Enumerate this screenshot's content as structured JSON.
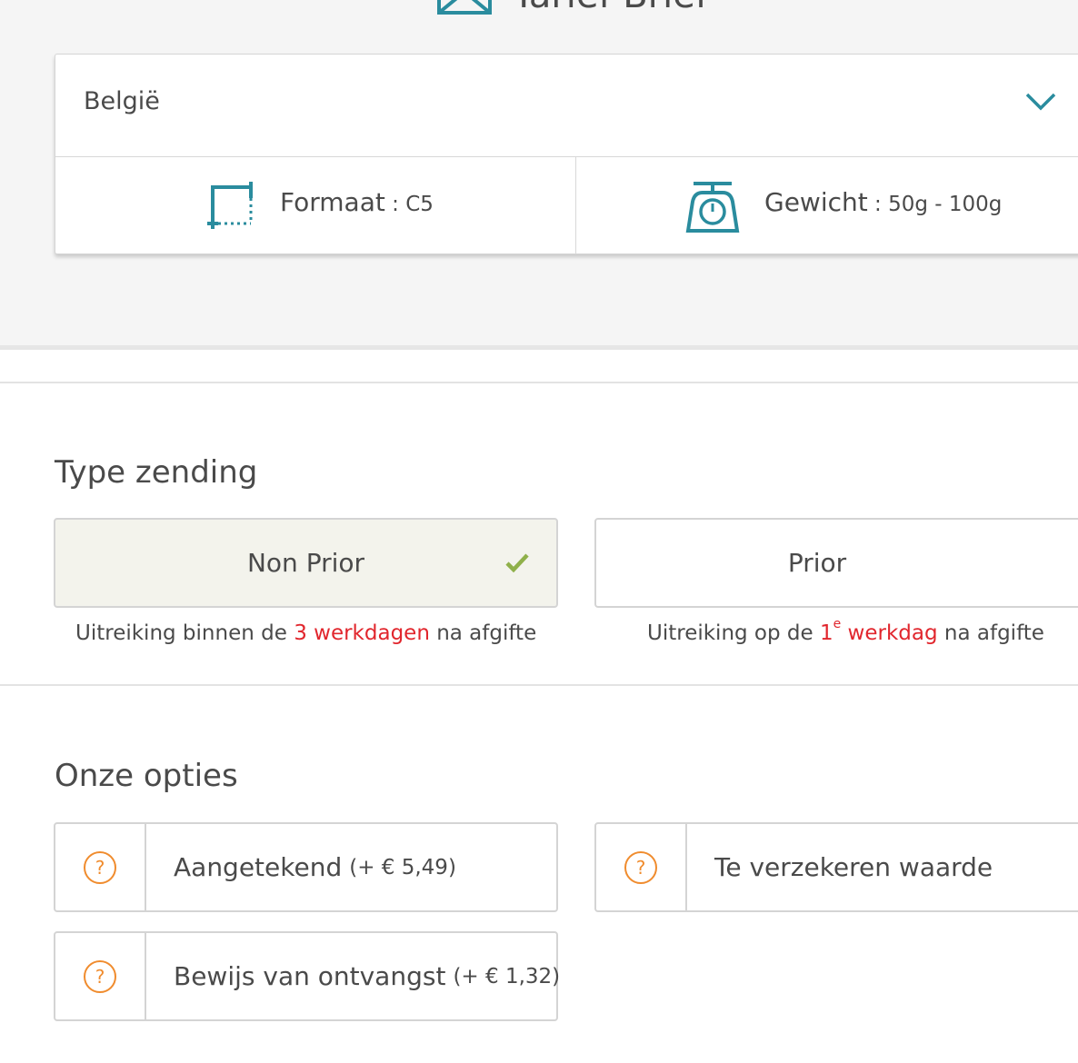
{
  "header": {
    "title": "Tarief Brief",
    "icon": "envelope-icon"
  },
  "selector": {
    "country": "België",
    "format_label": "Formaat",
    "format_separator": " : ",
    "format_value": "C5",
    "weight_label": "Gewicht",
    "weight_separator": " : ",
    "weight_value": "50g - 100g"
  },
  "shipping_type": {
    "title": "Type zending",
    "options": [
      {
        "label": "Non Prior",
        "selected": true,
        "desc_pre": "Uitreiking binnen de ",
        "desc_hl": "3 werkdagen",
        "desc_post": " na afgifte"
      },
      {
        "label": "Prior",
        "selected": false,
        "desc_pre": "Uitreiking op de ",
        "desc_hl_num": "1",
        "desc_hl_sup": "e",
        "desc_hl_word": " werkdag",
        "desc_post": " na afgifte"
      }
    ]
  },
  "options_section": {
    "title": "Onze opties",
    "help_glyph": "?",
    "items": [
      {
        "name": "Aangetekend",
        "price": "(+ € 5,49)"
      },
      {
        "name": "Te verzekeren waarde",
        "price": ""
      },
      {
        "name": "Bewijs van ontvangst",
        "price": "(+ € 1,32)"
      }
    ]
  },
  "colors": {
    "accent": "#2a8c9e",
    "highlight": "#e1262d",
    "help": "#f08c2e",
    "check": "#8fb04a"
  }
}
